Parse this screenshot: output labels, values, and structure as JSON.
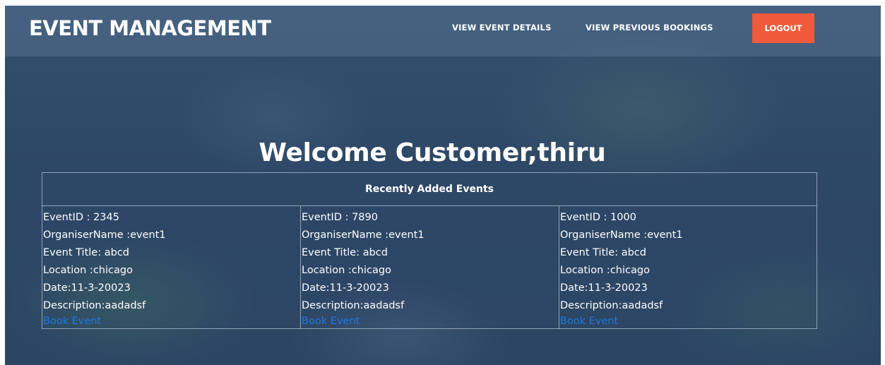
{
  "header": {
    "brand": "EVENT MANAGEMENT",
    "nav": [
      {
        "label": "VIEW EVENT DETAILS"
      },
      {
        "label": "VIEW PREVIOUS BOOKINGS"
      }
    ],
    "logout_label": "LOGOUT"
  },
  "welcome": "Welcome Customer,thiru",
  "events_section": {
    "title": "Recently Added Events",
    "events": [
      {
        "event_id": "EventID : 2345",
        "organiser": "OrganiserName :event1",
        "title": "Event Title: abcd",
        "location": "Location :chicago",
        "date": "Date:11-3-20023",
        "description": "Description:aadadsf",
        "book_label": "Book Event"
      },
      {
        "event_id": "EventID : 7890",
        "organiser": "OrganiserName :event1",
        "title": "Event Title: abcd",
        "location": "Location :chicago",
        "date": "Date:11-3-20023",
        "description": "Description:aadadsf",
        "book_label": "Book Event"
      },
      {
        "event_id": "EventID : 1000",
        "organiser": "OrganiserName :event1",
        "title": "Event Title: abcd",
        "location": "Location :chicago",
        "date": "Date:11-3-20023",
        "description": "Description:aadadsf",
        "book_label": "Book Event"
      }
    ]
  },
  "colors": {
    "background": "#2d4766",
    "logout_button": "#ef5a3c",
    "link": "#1c78e0",
    "text": "#ffffff"
  }
}
